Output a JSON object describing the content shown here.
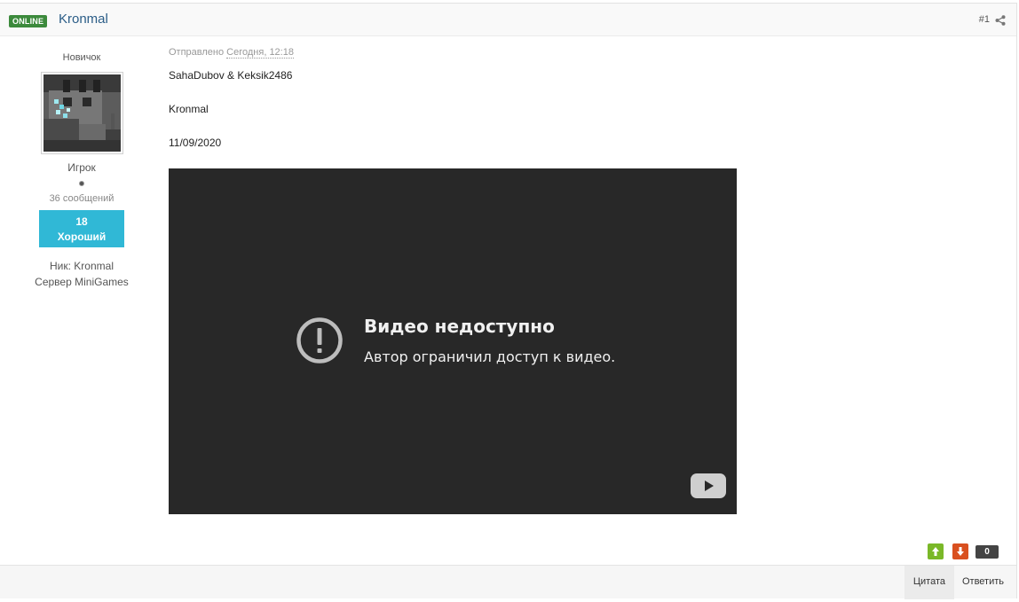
{
  "header": {
    "online_badge": "ONLINE",
    "author_name": "Kronmal",
    "post_number": "#1"
  },
  "author": {
    "rank_title": "Новичок",
    "group_name": "Игрок",
    "post_count": "36 сообщений",
    "reputation_value": "18",
    "reputation_label": "Хороший",
    "nick_label": "Ник:",
    "nick_value": "Kronmal",
    "server_label": "Сервер",
    "server_value": "MiniGames"
  },
  "post": {
    "posted_label": "Отправлено",
    "posted_date": "Сегодня, 12:18",
    "line1": "SahaDubov &  Keksik2486",
    "line2": "Kronmal",
    "line3": "11/09/2020"
  },
  "video": {
    "title": "Видео недоступно",
    "subtitle": "Автор ограничил доступ к видео.",
    "background": "#282828"
  },
  "votes": {
    "count": "0",
    "up_color": "#7ab828",
    "down_color": "#d9501f"
  },
  "footer": {
    "quote_label": "Цитата",
    "reply_label": "Ответить"
  },
  "colors": {
    "online": "#3c8a3c",
    "reputation": "#30b8d6",
    "author_link": "#2b5d87"
  }
}
